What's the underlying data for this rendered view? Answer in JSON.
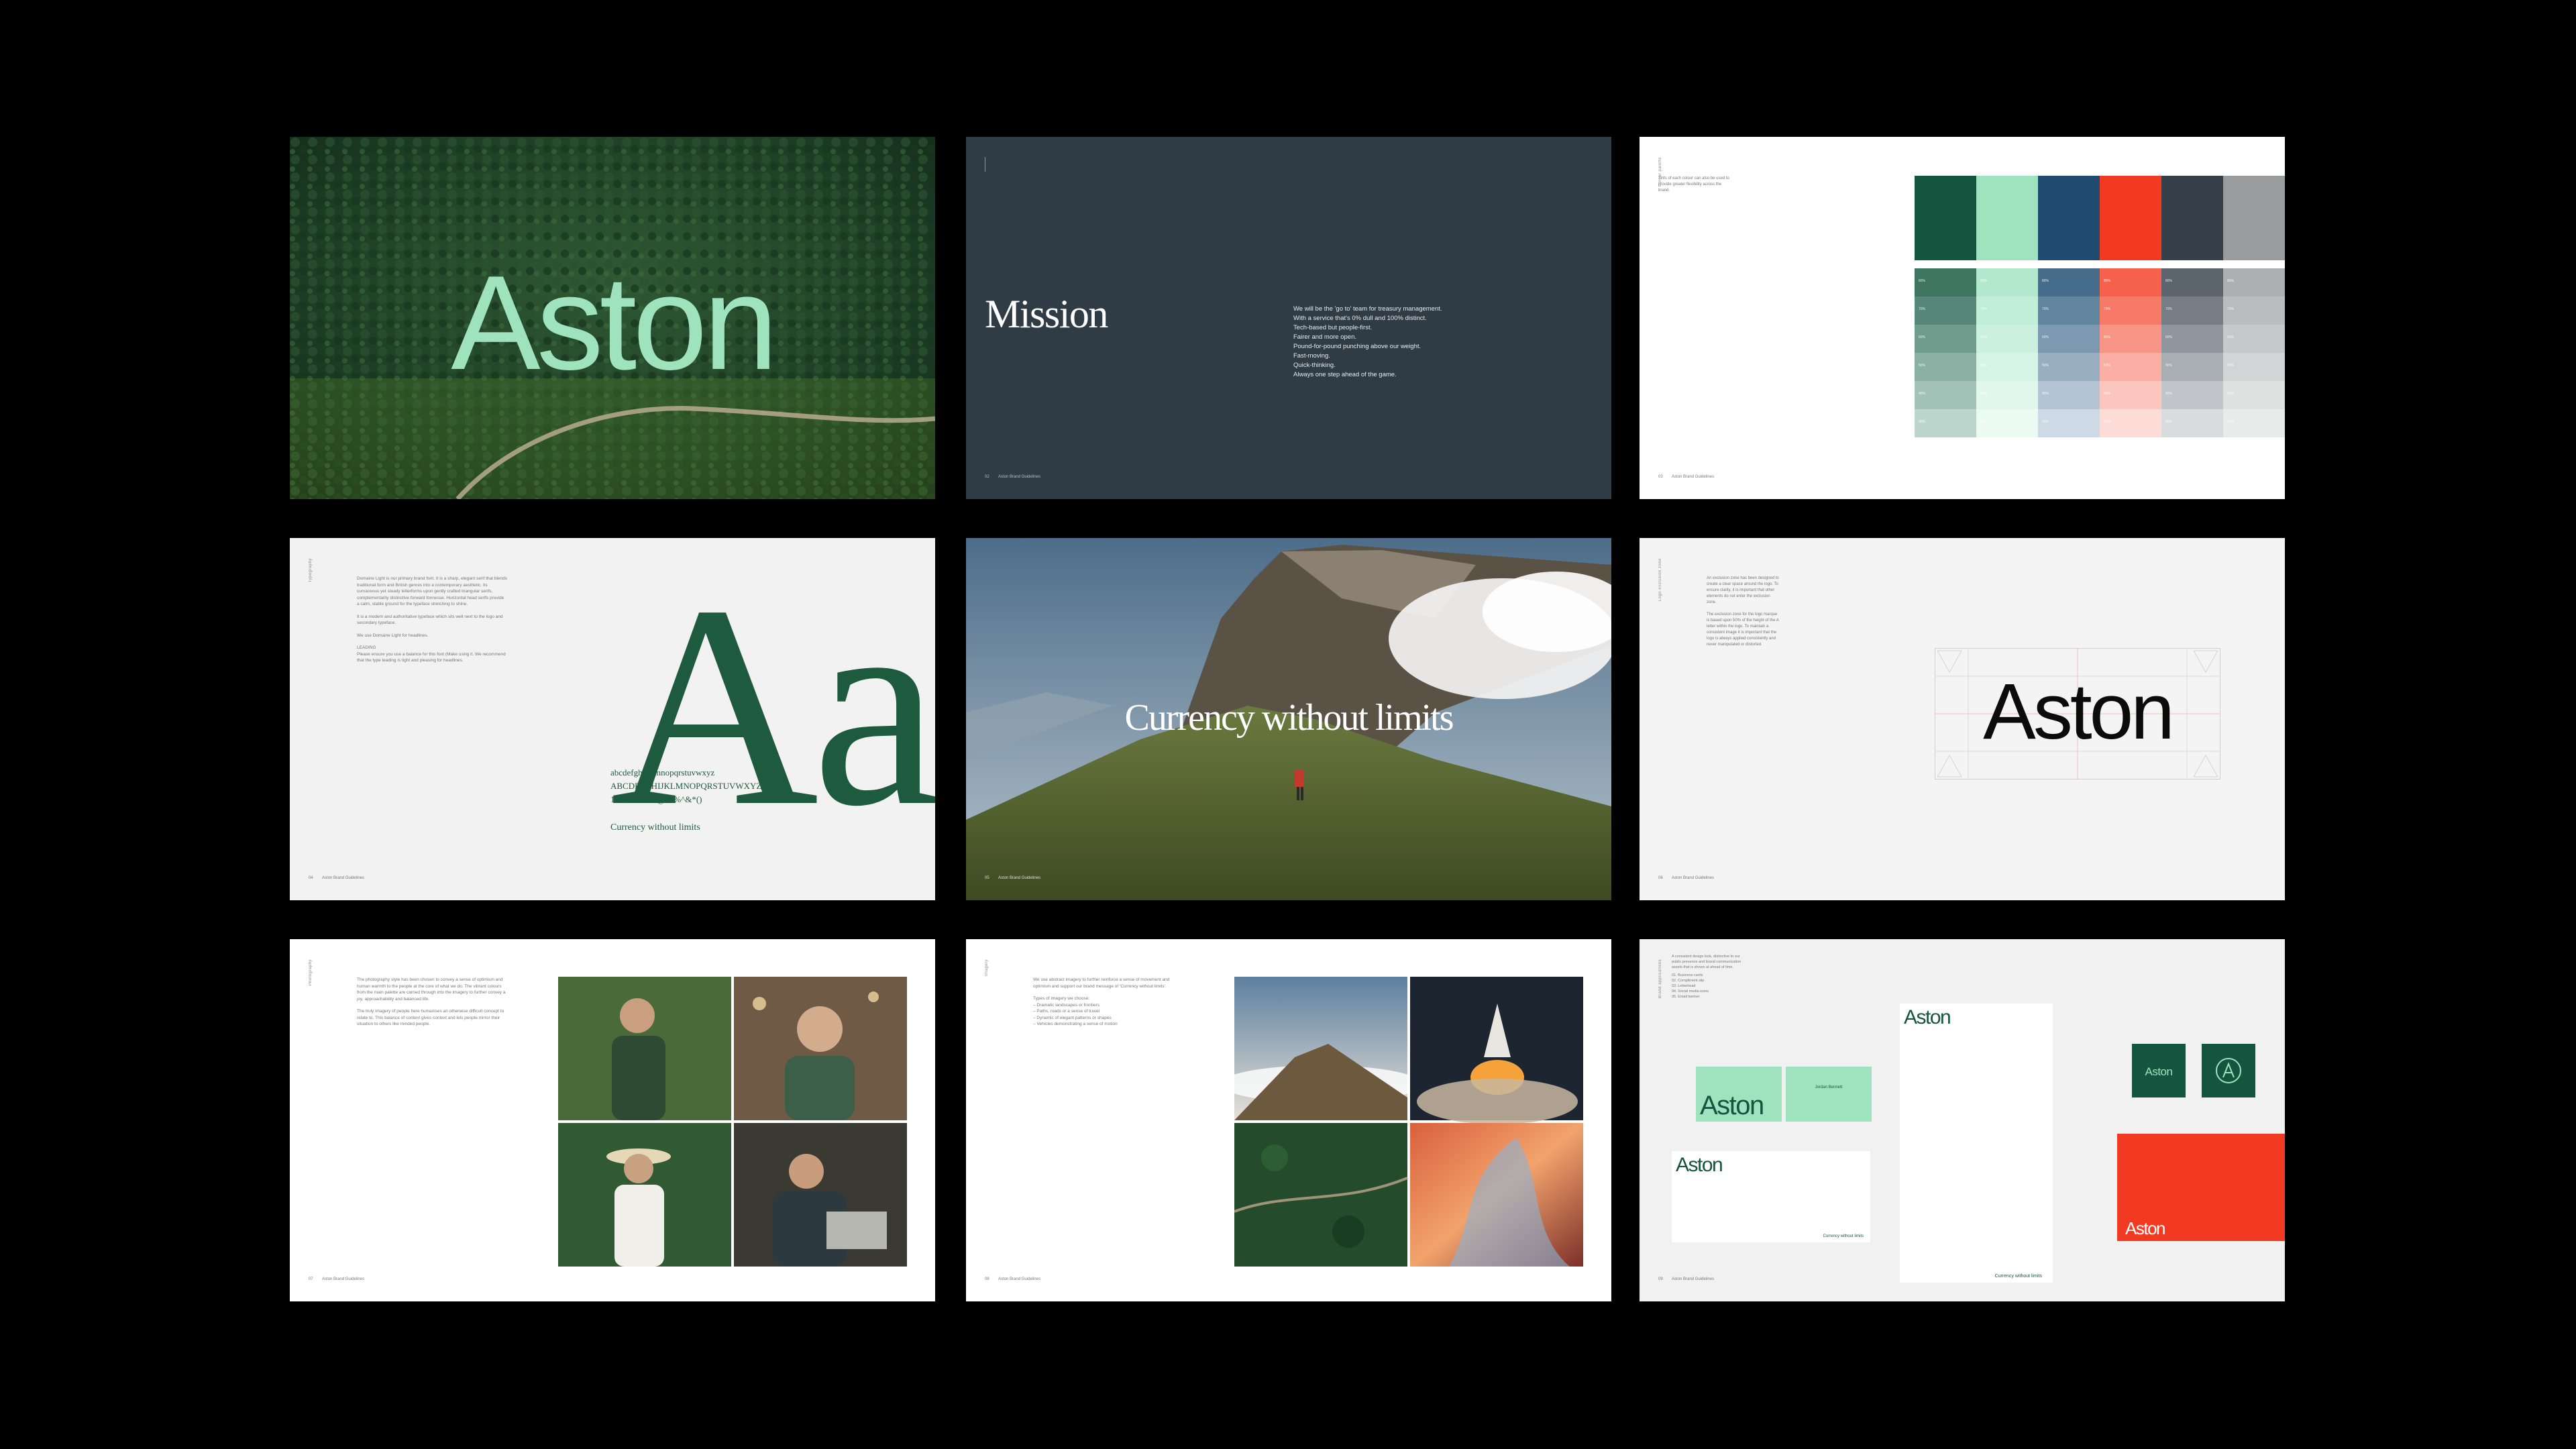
{
  "slides": {
    "cover": {
      "wordmark": "Aston"
    },
    "mission": {
      "title": "Mission",
      "lines": [
        "We will be the 'go to' team for treasury management.",
        "With a service that's 0% dull and 100% distinct.",
        "Tech-based but people-first.",
        "Fairer and more open.",
        "Pound-for-pound punching above our weight.",
        "Fast-moving.",
        "Quick-thinking.",
        "Always one step ahead of the game."
      ],
      "footer_num": "02",
      "footer_text": "Aston Brand Guidelines"
    },
    "colour": {
      "side_label": "Colour palette",
      "intro": "Tints of each colour can also be used to provide greater flexibility across the brand.",
      "swatches": [
        "#155540",
        "#9ee3be",
        "#1f4b73",
        "#f23a22",
        "#36404a",
        "#9a9b9d"
      ],
      "tints": [
        [
          "#3d7561",
          "#b2e9cc",
          "#476d8d",
          "#f5614d",
          "#5c656e",
          "#aeafb1"
        ],
        [
          "#56877a",
          "#c1eed7",
          "#6285a0",
          "#f77a69",
          "#767d85",
          "#bbbcbe"
        ],
        [
          "#709c8e",
          "#ccf0de",
          "#7c99b1",
          "#f99586",
          "#90969d",
          "#c7c8c9"
        ],
        [
          "#8ab0a3",
          "#d6f4e5",
          "#98afc2",
          "#fbaea3",
          "#a9aeb3",
          "#d3d4d5"
        ],
        [
          "#a4c3b8",
          "#e1f7ec",
          "#b3c5d4",
          "#fcc6be",
          "#c2c6ca",
          "#dfe0e0"
        ],
        [
          "#bdd6cd",
          "#ebfaf3",
          "#cdd9e4",
          "#fddcd7",
          "#d9dcde",
          "#e9eaea"
        ]
      ],
      "tint_labels": [
        "80%",
        "70%",
        "60%",
        "50%",
        "40%",
        "30%"
      ],
      "footer_num": "03",
      "footer_text": "Aston Brand Guidelines"
    },
    "typography": {
      "side_label": "Typography",
      "paragraphs": [
        "Domaine Light is our primary brand font. It is a sharp, elegant serif that blends traditional form and British genres into a contemporary aesthetic. Its curvaceous yet steady letterforms upon gently crafted triangular serifs, complementarity distinctive forward fonnesse. Horizontal head serifs provide a calm, stable ground for the typeface stretching to shine.",
        "It is a modern and authoritative typeface which sits well next to the logo and secondary typeface.",
        "We use Domaine Light for headlines.",
        "LEADING",
        "Please ensure you use a balance for this font (Make using it. We recommend that the type leading is tight and pleasing for headlines."
      ],
      "specimen": "Aa",
      "lower": "abcdefghijklmnopqrstuvwxyz",
      "upper": "ABCDEFGHIJKLMNOPQRSTUVWXYZ",
      "figures": "1234567890!@£$%^&*()",
      "sample": "Currency without limits",
      "footer_num": "04",
      "footer_text": "Aston Brand Guidelines"
    },
    "hero": {
      "headline": "Currency without limits",
      "footer_num": "05",
      "footer_text": "Aston Brand Guidelines"
    },
    "logo": {
      "side_label": "Logo exclusion zone",
      "paragraphs": [
        "An exclusion zone has been designed to create a clear space around the logo. To ensure clarity, it is important that other elements do not enter the exclusion zone.",
        "The exclusion zone for the logo marque is based upon 50% of the height of the A letter within the logo. To maintain a consistent image it is important that the logo is always applied consistently and never manipulated or distorted."
      ],
      "wordmark": "Aston",
      "footer_num": "06",
      "footer_text": "Aston Brand Guidelines"
    },
    "photography": {
      "side_label": "Photography",
      "paragraphs": [
        "The photography style has been chosen to convey a sense of optimism and human warmth to the people at the core of what we do. The vibrant colours from the main palette are carried through into the imagery to further convey a joy, approachability and balanced life.",
        "The truly imagery of people here humanises an otherwise difficult concept to relate to. This balance of content gives context and lets people mirror their situation to others like minded people."
      ],
      "footer_num": "07",
      "footer_text": "Aston Brand Guidelines"
    },
    "imagery": {
      "side_label": "Imagery",
      "paragraphs": [
        "We use abstract imagery to further reinforce a sense of movement and optimism and support our brand message of 'Currency without limits'."
      ],
      "list_title": "Types of imagery we choose:",
      "list": [
        "Dramatic landscapes or frontiers",
        "Paths, roads or a sense of travel",
        "Dynamic of elegant patterns or shapes",
        "Vehicles demonstrating a sense of motion"
      ],
      "footer_num": "08",
      "footer_text": "Aston Brand Guidelines"
    },
    "stationery": {
      "side_label": "Brand applications",
      "intro": "A consistent design look, distinctive to our public presence and brand communication assets that is shown at ahead of time.",
      "list": [
        "01. Business cards",
        "02. Compliment slip",
        "03. Letterhead",
        "04. Social media icons",
        "05. Email banner"
      ],
      "wordmark": "Aston",
      "tagline": "Currency without limits",
      "card_name": "Jordan Bennett",
      "footer_num": "09",
      "footer_text": "Aston Brand Guidelines"
    }
  },
  "colors": {
    "background": "#000000",
    "aston_green": "#155540",
    "aston_mint": "#9ee3be",
    "aston_navy": "#1f4b73",
    "aston_red": "#f23a22",
    "aston_slate": "#36404a",
    "aston_grey": "#9a9b9d"
  }
}
